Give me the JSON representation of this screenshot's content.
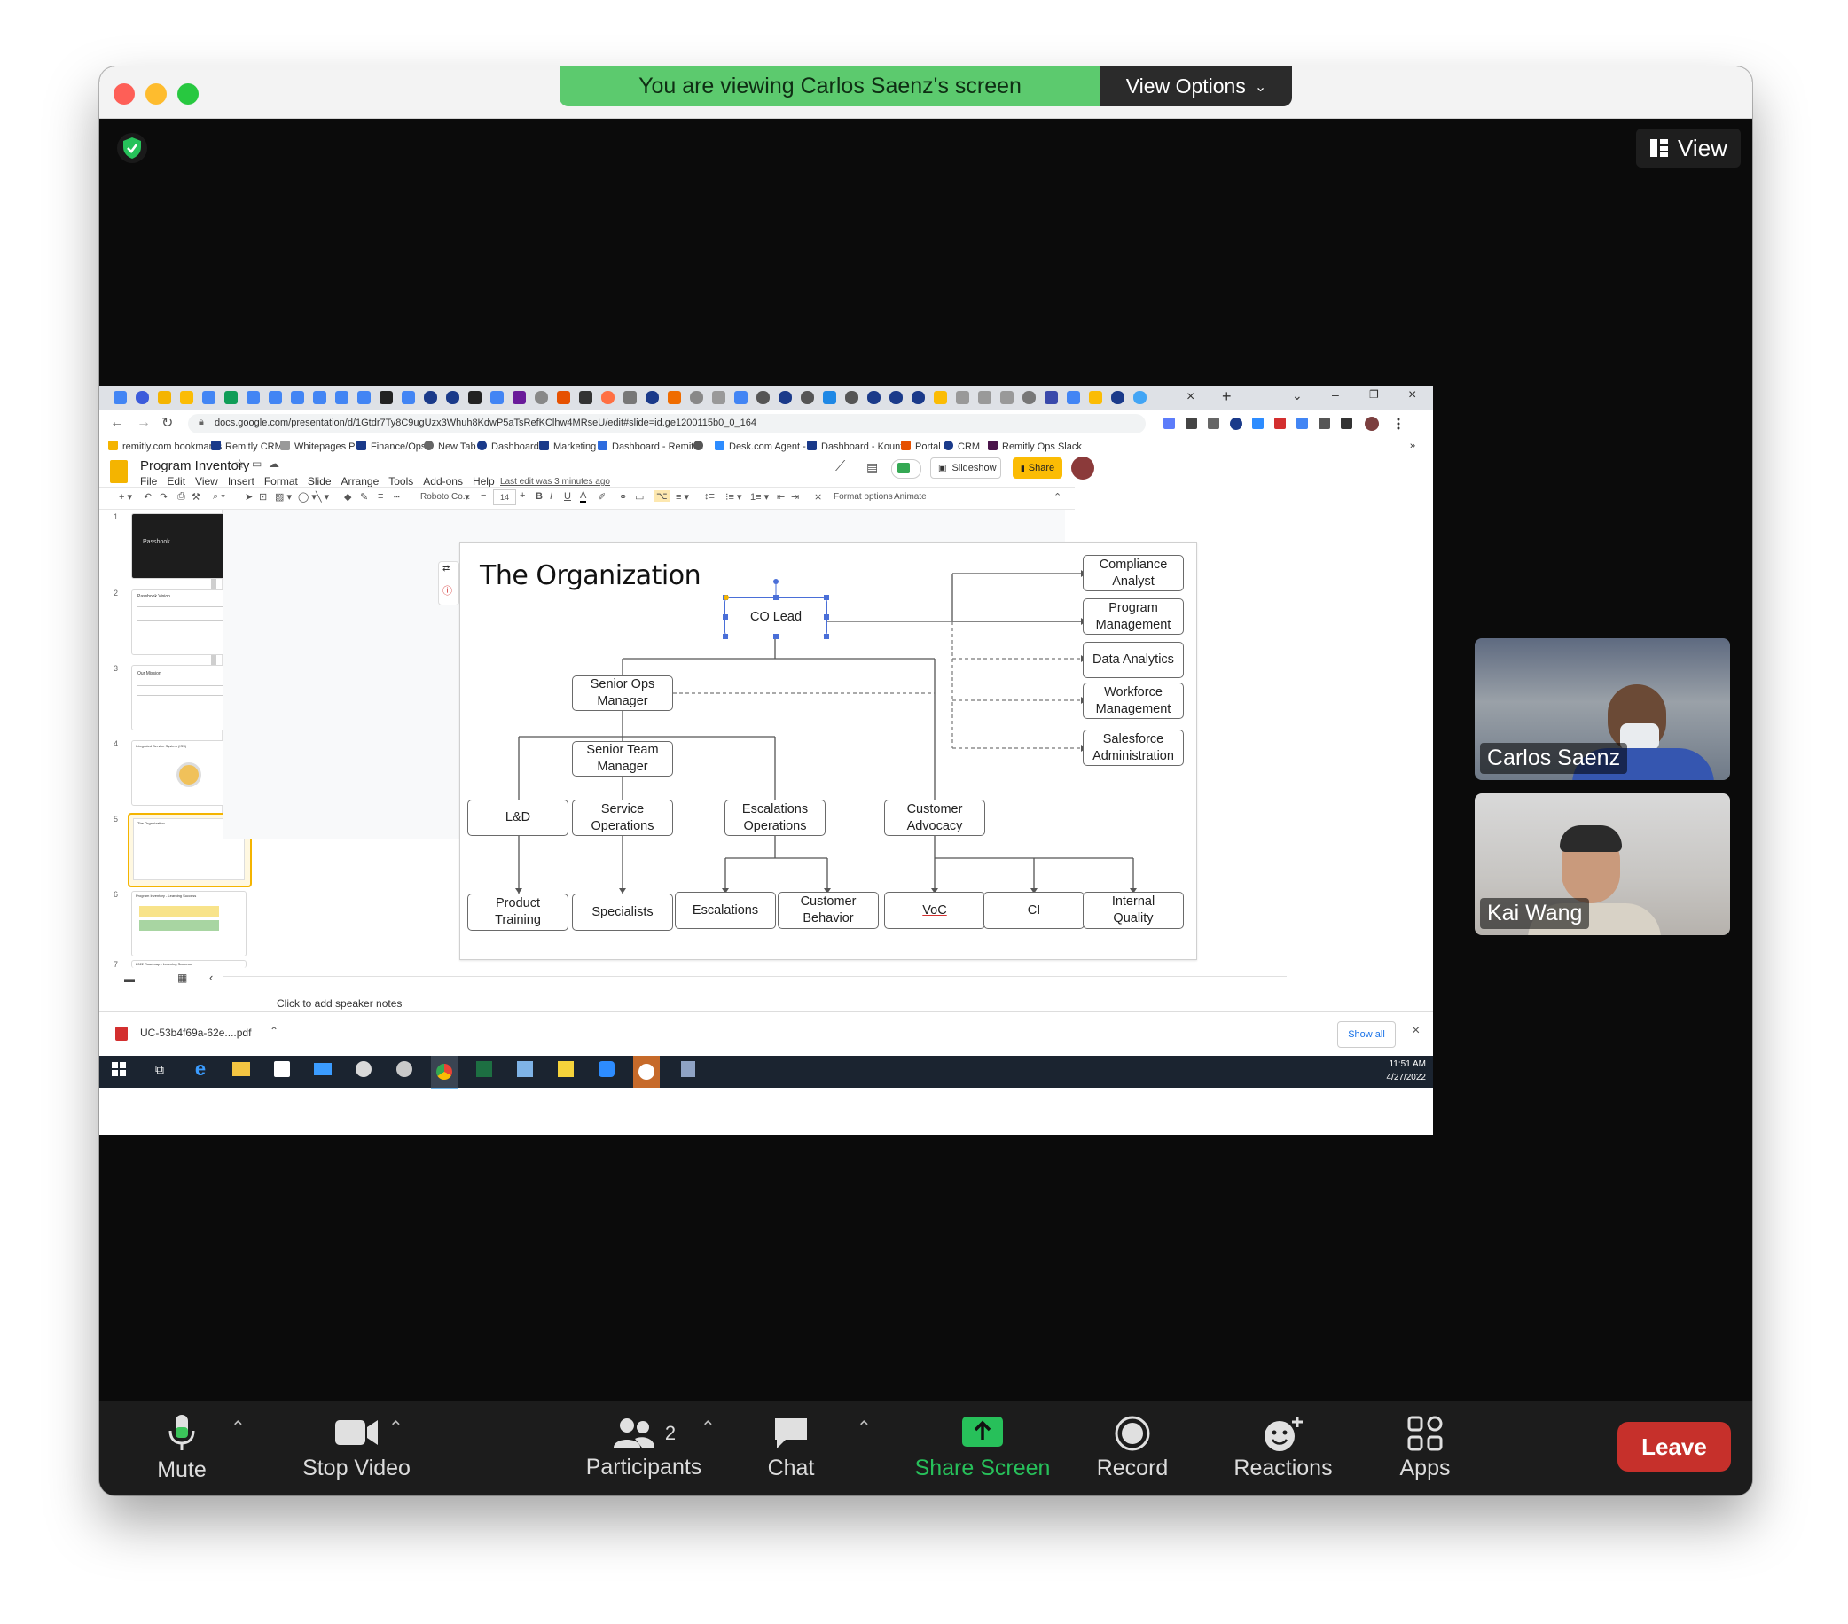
{
  "zoom": {
    "banner": "You are viewing Carlos Saenz's screen",
    "view_options": "View Options",
    "view_button": "View",
    "participants": [
      {
        "name": "Carlos Saenz"
      },
      {
        "name": "Kai Wang"
      }
    ],
    "toolbar": {
      "mute": "Mute",
      "stop_video": "Stop Video",
      "participants": "Participants",
      "participants_count": "2",
      "chat": "Chat",
      "share_screen": "Share Screen",
      "record": "Record",
      "reactions": "Reactions",
      "apps": "Apps",
      "leave": "Leave"
    }
  },
  "browser": {
    "url": "docs.google.com/presentation/d/1Gtdr7Ty8C9ugUzx3Whuh8KdwP5aTsRefKClhw4MRseU/edit#slide=id.ge1200115b0_0_164",
    "bookmarks": [
      "remitly.com bookmarks",
      "Remitly CRM",
      "Whitepages Pro",
      "Finance/Ops",
      "New Tab",
      "Dashboard",
      "Marketing",
      "Dashboard - Remitl...",
      "Desk.com Agent -...",
      "Dashboard - Kount...",
      "Portal",
      "CRM",
      "Remitly Ops Slack"
    ],
    "download_file": "UC-53b4f69a-62e....pdf",
    "show_all": "Show all"
  },
  "slides": {
    "doc_title": "Program Inventory",
    "menu": [
      "File",
      "Edit",
      "View",
      "Insert",
      "Format",
      "Slide",
      "Arrange",
      "Tools",
      "Add-ons",
      "Help"
    ],
    "last_edit": "Last edit was 3 minutes ago",
    "slideshow": "Slideshow",
    "share": "Share",
    "font_name": "Roboto Co...",
    "font_size": "14",
    "format_options": "Format options",
    "animate": "Animate",
    "speaker_notes": "Click to add speaker notes",
    "thumbnails": [
      {
        "num": "1",
        "title": "Passbook"
      },
      {
        "num": "2",
        "title": "Passbook Vision"
      },
      {
        "num": "3",
        "title": "Our Mission"
      },
      {
        "num": "4",
        "title": "Integrated Service System (ISS)"
      },
      {
        "num": "5",
        "title": "The Organization"
      },
      {
        "num": "6",
        "title": "Program Inventory - Learning Success"
      },
      {
        "num": "7",
        "title": "2022 Roadmap - Learning Success"
      }
    ],
    "slide_title": "The Organization",
    "org": {
      "co_lead": "CO Lead",
      "senior_ops": "Senior Ops\nManager",
      "senior_team": "Senior Team\nManager",
      "ld": "L&D",
      "service_ops": "Service\nOperations",
      "escalations_ops": "Escalations\nOperations",
      "customer_advocacy": "Customer\nAdvocacy",
      "product_training": "Product\nTraining",
      "specialists": "Specialists",
      "escalations": "Escalations",
      "customer_behavior": "Customer\nBehavior",
      "voc": "VoC",
      "ci": "CI",
      "internal_quality": "Internal\nQuality",
      "compliance": "Compliance\nAnalyst",
      "program_mgmt": "Program\nManagement",
      "data_analytics": "Data Analytics",
      "workforce": "Workforce\nManagement",
      "salesforce": "Salesforce\nAdministration"
    }
  },
  "taskbar": {
    "time": "11:51 AM",
    "date": "4/27/2022"
  }
}
